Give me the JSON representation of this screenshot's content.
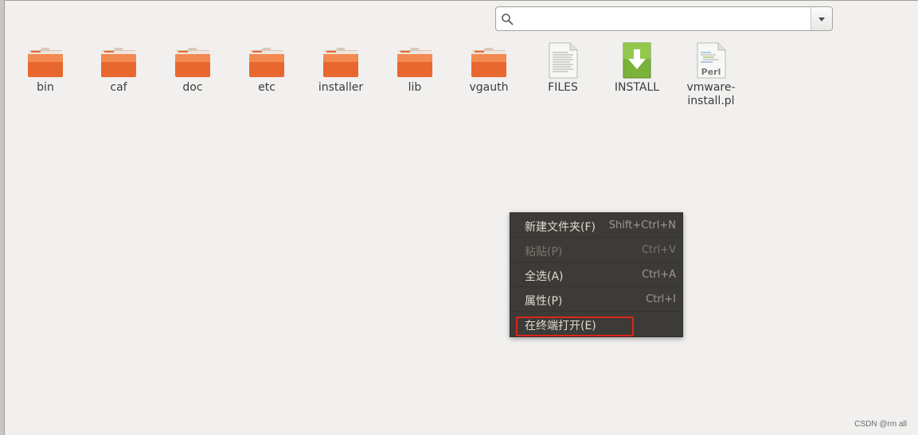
{
  "search": {
    "value": "",
    "placeholder": ""
  },
  "files": [
    {
      "name": "bin",
      "icon": "folder-icon"
    },
    {
      "name": "caf",
      "icon": "folder-icon"
    },
    {
      "name": "doc",
      "icon": "folder-icon"
    },
    {
      "name": "etc",
      "icon": "folder-icon"
    },
    {
      "name": "installer",
      "icon": "folder-icon"
    },
    {
      "name": "lib",
      "icon": "folder-icon"
    },
    {
      "name": "vgauth",
      "icon": "folder-icon"
    },
    {
      "name": "FILES",
      "icon": "text-document-icon"
    },
    {
      "name": "INSTALL",
      "icon": "install-download-icon"
    },
    {
      "name": "vmware-install.pl",
      "label_line1": "vmware-",
      "label_line2": "install.pl",
      "icon": "perl-script-icon",
      "icon_text": "Perl"
    }
  ],
  "context_menu": {
    "items": [
      {
        "label": "新建文件夹(F)",
        "shortcut": "Shift+Ctrl+N",
        "enabled": true
      },
      {
        "label": "粘贴(P)",
        "shortcut": "Ctrl+V",
        "enabled": false
      },
      {
        "label": "全选(A)",
        "shortcut": "Ctrl+A",
        "enabled": true
      },
      {
        "label": "属性(P)",
        "shortcut": "Ctrl+I",
        "enabled": true
      },
      {
        "label": "在终端打开(E)",
        "shortcut": "",
        "enabled": true,
        "highlighted": true
      }
    ]
  },
  "watermark": "CSDN @rm all",
  "colors": {
    "folder_orange": "#e8672e",
    "menu_bg": "#3c3b37",
    "highlight_red": "#e0241a",
    "install_green": "#7bb33a"
  }
}
